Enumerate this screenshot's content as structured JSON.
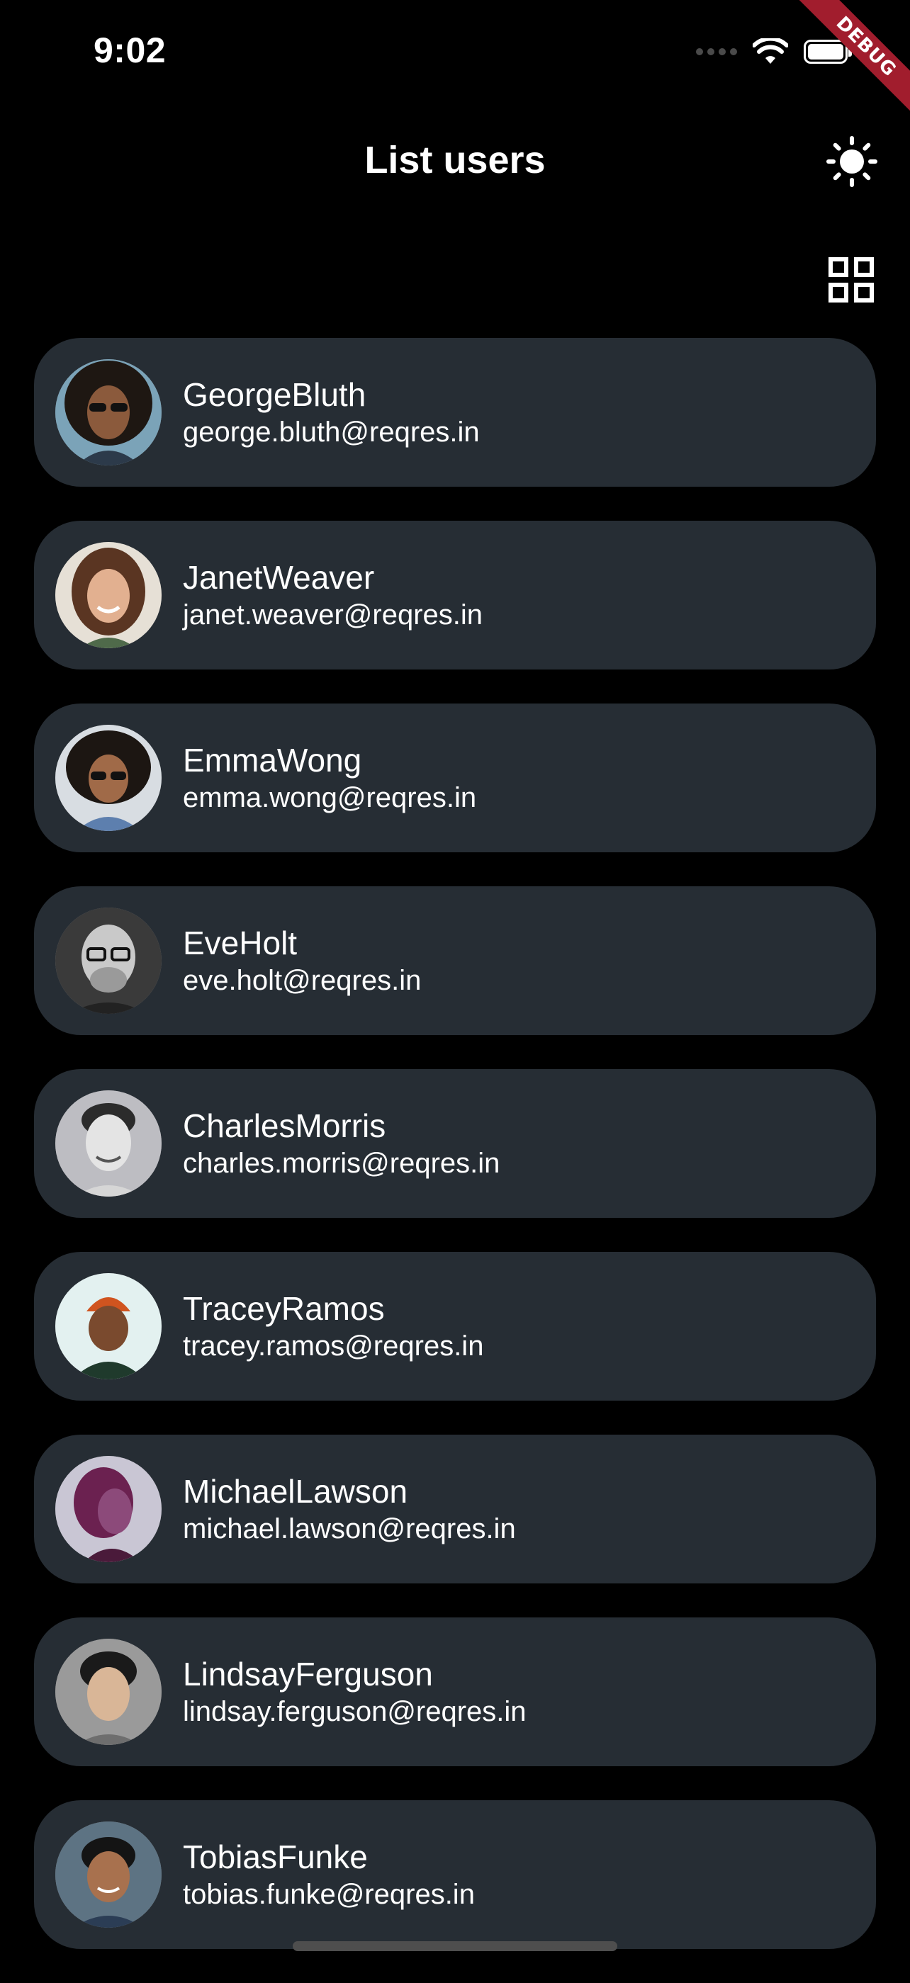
{
  "status_bar": {
    "time": "9:02"
  },
  "debug_banner": "DEBUG",
  "app_bar": {
    "title": "List users",
    "theme_icon": "sun-icon",
    "layout_icon": "grid-view-icon"
  },
  "colors": {
    "background": "#000000",
    "card": "#262d34",
    "text": "#ffffff",
    "debug_banner": "#a11d2d"
  },
  "users": [
    {
      "name": "GeorgeBluth",
      "email": "george.bluth@reqres.in"
    },
    {
      "name": "JanetWeaver",
      "email": "janet.weaver@reqres.in"
    },
    {
      "name": "EmmaWong",
      "email": "emma.wong@reqres.in"
    },
    {
      "name": "EveHolt",
      "email": "eve.holt@reqres.in"
    },
    {
      "name": "CharlesMorris",
      "email": "charles.morris@reqres.in"
    },
    {
      "name": "TraceyRamos",
      "email": "tracey.ramos@reqres.in"
    },
    {
      "name": "MichaelLawson",
      "email": "michael.lawson@reqres.in"
    },
    {
      "name": "LindsayFerguson",
      "email": "lindsay.ferguson@reqres.in"
    },
    {
      "name": "TobiasFunke",
      "email": "tobias.funke@reqres.in"
    }
  ]
}
